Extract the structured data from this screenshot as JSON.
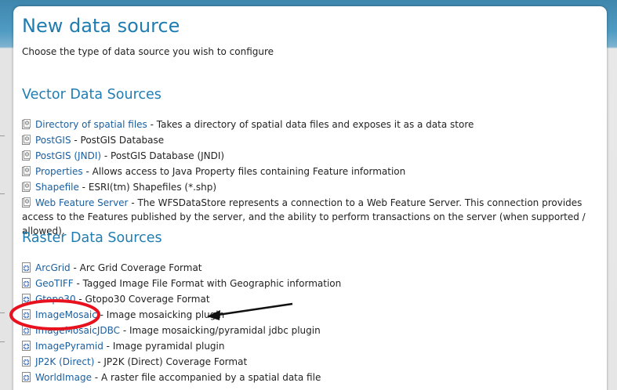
{
  "page": {
    "title": "New data source",
    "subtitle": "Choose the type of data source you wish to configure"
  },
  "vector": {
    "heading": "Vector Data Sources",
    "items": [
      {
        "label": "Directory of spatial files",
        "desc": " - Takes a directory of spatial data files and exposes it as a data store",
        "icon": "vector-store-icon"
      },
      {
        "label": "PostGIS",
        "desc": " - PostGIS Database",
        "icon": "vector-store-icon"
      },
      {
        "label": "PostGIS (JNDI)",
        "desc": " - PostGIS Database (JNDI)",
        "icon": "vector-store-icon"
      },
      {
        "label": "Properties",
        "desc": " - Allows access to Java Property files containing Feature information",
        "icon": "vector-store-icon"
      },
      {
        "label": "Shapefile",
        "desc": " - ESRI(tm) Shapefiles (*.shp)",
        "icon": "vector-store-icon"
      },
      {
        "label": "Web Feature Server",
        "desc": " - The WFSDataStore represents a connection to a Web Feature Server. This connection provides access to the Features published by the server, and the ability to perform transactions on the server (when supported / allowed).",
        "icon": "vector-store-icon"
      }
    ]
  },
  "raster": {
    "heading": "Raster Data Sources",
    "items": [
      {
        "label": "ArcGrid",
        "desc": " - Arc Grid Coverage Format",
        "icon": "raster-store-icon"
      },
      {
        "label": "GeoTIFF",
        "desc": " - Tagged Image File Format with Geographic information",
        "icon": "raster-store-icon"
      },
      {
        "label": "Gtopo30",
        "desc": " - Gtopo30 Coverage Format",
        "icon": "raster-store-icon"
      },
      {
        "label": "ImageMosaic",
        "desc": " - Image mosaicking plugin",
        "icon": "raster-store-icon"
      },
      {
        "label": "ImageMosaicJDBC",
        "desc": " - Image mosaicking/pyramidal jdbc plugin",
        "icon": "raster-store-icon"
      },
      {
        "label": "ImagePyramid",
        "desc": " - Image pyramidal plugin",
        "icon": "raster-store-icon"
      },
      {
        "label": "JP2K (Direct)",
        "desc": " - JP2K (Direct) Coverage Format",
        "icon": "raster-store-icon"
      },
      {
        "label": "WorldImage",
        "desc": " - A raster file accompanied by a spatial data file",
        "icon": "raster-store-icon"
      }
    ]
  },
  "annotation": {
    "color": "#e8121f",
    "arrow_color": "#111111",
    "highlighted_item": "ImageMosaic"
  }
}
